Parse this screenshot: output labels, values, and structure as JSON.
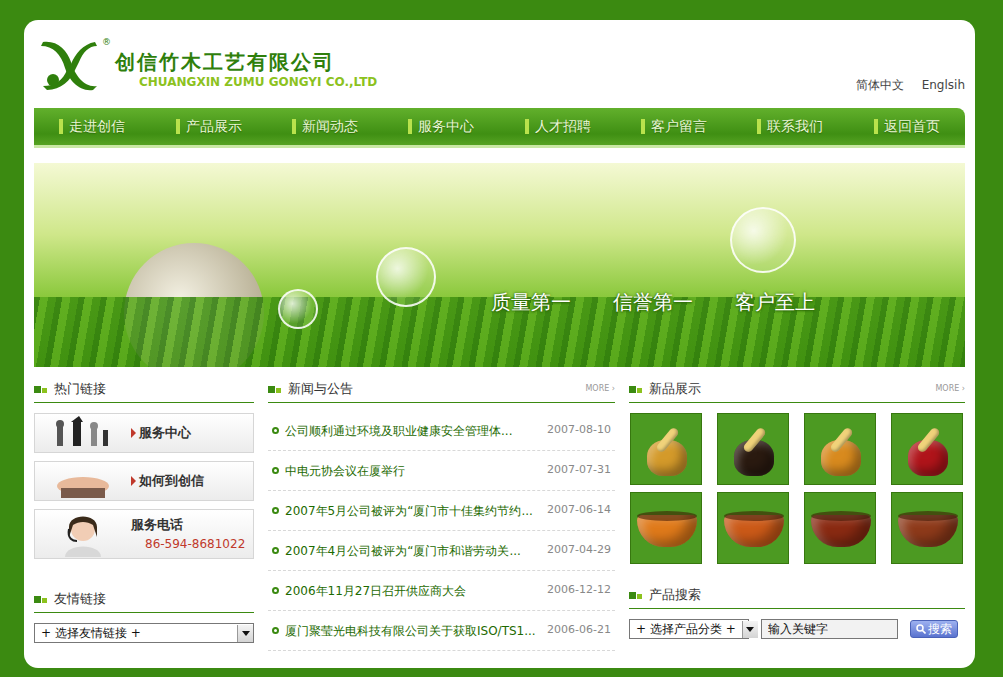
{
  "header": {
    "company": "创信竹木工艺有限公司",
    "company_en": "CHUANGXIN ZUMU GONGYI CO.,LTD",
    "logo_mark": "®",
    "languages": [
      {
        "label": "简体中文"
      },
      {
        "label": "Englsih"
      }
    ]
  },
  "nav": [
    {
      "label": "走进创信"
    },
    {
      "label": "产品展示"
    },
    {
      "label": "新闻动态"
    },
    {
      "label": "服务中心"
    },
    {
      "label": "人才招聘"
    },
    {
      "label": "客户留言"
    },
    {
      "label": "联系我们"
    },
    {
      "label": "返回首页"
    }
  ],
  "banner": {
    "slogans": [
      "质量第一",
      "信誉第一",
      "客户至上"
    ]
  },
  "hot_links": {
    "title": "热门链接",
    "items": [
      {
        "label": "服务中心",
        "kind": "chess"
      },
      {
        "label": "如何到创信",
        "kind": "hand"
      },
      {
        "label": "服务电话",
        "phone": "86-594-8681022",
        "kind": "phone"
      }
    ]
  },
  "friend_links": {
    "title": "友情链接",
    "select": "+ 选择友情链接 +"
  },
  "news": {
    "title": "新闻与公告",
    "more": "MORE ›",
    "items": [
      {
        "title": "公司顺利通过环境及职业健康安全管理体...",
        "date": "2007-08-10"
      },
      {
        "title": "中电元协会议在厦举行",
        "date": "2007-07-31"
      },
      {
        "title": "2007年5月公司被评为“厦门市十佳集约节约...",
        "date": "2007-06-14"
      },
      {
        "title": "2007年4月公司被评为“厦门市和谐劳动关...",
        "date": "2007-04-29"
      },
      {
        "title": "2006年11月27日召开供应商大会",
        "date": "2006-12-12"
      },
      {
        "title": "厦门聚莹光电科技有限公司关于获取ISO/TS1...",
        "date": "2006-06-21"
      }
    ]
  },
  "new_products": {
    "title": "新品展示",
    "more": "MORE ›",
    "items": [
      {
        "kind": "mortar",
        "color": "#d49a2a"
      },
      {
        "kind": "mortar",
        "color": "#2a1a10"
      },
      {
        "kind": "mortar",
        "color": "#d88a1e"
      },
      {
        "kind": "mortar",
        "color": "#b0141a"
      },
      {
        "kind": "bowl",
        "color": "#e07a1a"
      },
      {
        "kind": "bowl",
        "color": "#cc5a18"
      },
      {
        "kind": "bowl",
        "color": "#8a2a12"
      },
      {
        "kind": "bowl",
        "color": "#8e3a1a"
      }
    ]
  },
  "product_search": {
    "title": "产品搜索",
    "select": "+ 选择产品分类 +",
    "keyword": "输入关键字",
    "button": "搜索"
  }
}
